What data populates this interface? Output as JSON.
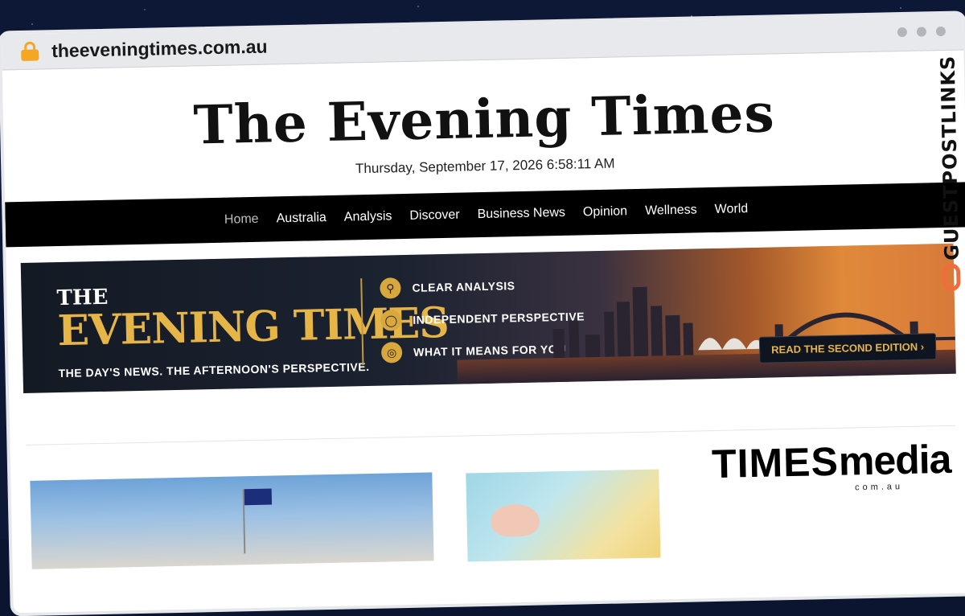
{
  "browser": {
    "url": "theeveningtimes.com.au"
  },
  "site": {
    "masthead": "The Evening Times",
    "dateline": "Thursday, September 17, 2026 6:58:11 AM"
  },
  "nav": {
    "items": [
      {
        "label": "Home"
      },
      {
        "label": "Australia"
      },
      {
        "label": "Analysis"
      },
      {
        "label": "Discover"
      },
      {
        "label": "Business News"
      },
      {
        "label": "Opinion"
      },
      {
        "label": "Wellness"
      },
      {
        "label": "World"
      }
    ]
  },
  "banner": {
    "the": "THE",
    "title": "EVENING TIMES",
    "slogan": "THE DAY'S NEWS.  THE AFTERNOON'S PERSPECTIVE.",
    "features": [
      {
        "label": "CLEAR ANALYSIS",
        "icon": "magnifier-icon"
      },
      {
        "label": "INDEPENDENT PERSPECTIVE",
        "icon": "globe-icon"
      },
      {
        "label": "WHAT IT MEANS FOR YOU",
        "icon": "target-icon"
      }
    ],
    "cta": "READ THE SECOND EDITION",
    "cta_arrow": "›"
  },
  "sidebar": {
    "logo_main": "TIMES",
    "logo_media": "media",
    "logo_sub": "com.au"
  },
  "watermark": {
    "text": "GUESTPOSTLINKS"
  }
}
